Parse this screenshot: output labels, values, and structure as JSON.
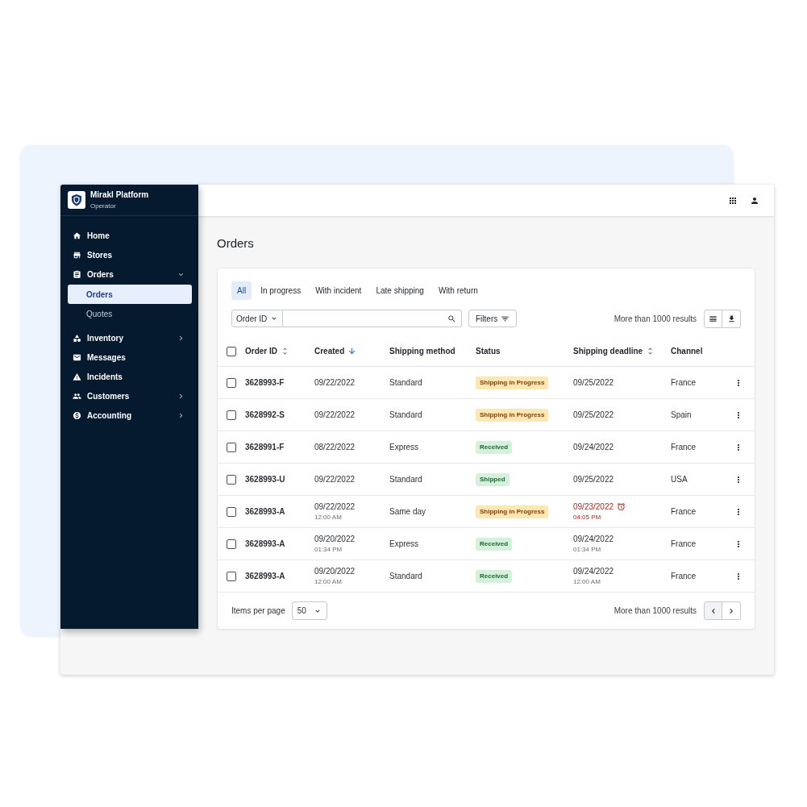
{
  "sidebar": {
    "brand": "Mirakl Platform",
    "role": "Operator",
    "items": [
      {
        "label": "Home",
        "selected": false
      },
      {
        "label": "Stores",
        "selected": false
      },
      {
        "label": "Orders",
        "selected": false,
        "expanded": true,
        "children": [
          {
            "label": "Orders",
            "selected": true
          },
          {
            "label": "Quotes",
            "selected": false
          }
        ]
      },
      {
        "label": "Inventory",
        "selected": false,
        "expanded": false
      },
      {
        "label": "Messages",
        "selected": false
      },
      {
        "label": "Incidents",
        "selected": false
      },
      {
        "label": "Customers",
        "selected": false,
        "expanded": false
      },
      {
        "label": "Accounting",
        "selected": false,
        "expanded": false
      }
    ]
  },
  "page_title": "Orders",
  "tabs": [
    {
      "label": "All",
      "selected": true
    },
    {
      "label": "In progress",
      "selected": false
    },
    {
      "label": "With incident",
      "selected": false
    },
    {
      "label": "Late shipping",
      "selected": false
    },
    {
      "label": "With return",
      "selected": false
    }
  ],
  "toolbar": {
    "search_scope": "Order ID",
    "filters": "Filters",
    "results": "More than 1000 results"
  },
  "table": {
    "select_all_checked": false,
    "columns": [
      {
        "label": "Order ID",
        "sortable": true,
        "sorted": false
      },
      {
        "label": "Created",
        "sortable": true,
        "sorted": true
      },
      {
        "label": "Shipping method",
        "sortable": false,
        "sorted": false
      },
      {
        "label": "Status",
        "sortable": false,
        "sorted": false
      },
      {
        "label": "Shipping deadline",
        "sortable": true,
        "sorted": false
      },
      {
        "label": "Channel",
        "sortable": false,
        "sorted": false
      }
    ],
    "rows": [
      {
        "checked": false,
        "order_id": "3628993-F",
        "created": {
          "date": "09/22/2022"
        },
        "shipping_method": "Standard",
        "status": {
          "label": "Shipping in Progress",
          "kind": "warning"
        },
        "deadline": {
          "date": "09/25/2022",
          "overdue": false
        },
        "channel": "France"
      },
      {
        "checked": false,
        "order_id": "3628992-S",
        "created": {
          "date": "09/22/2022"
        },
        "shipping_method": "Standard",
        "status": {
          "label": "Shipping in Progress",
          "kind": "warning"
        },
        "deadline": {
          "date": "09/25/2022",
          "overdue": false
        },
        "channel": "Spain"
      },
      {
        "checked": false,
        "order_id": "3628991-F",
        "created": {
          "date": "08/22/2022"
        },
        "shipping_method": "Express",
        "status": {
          "label": "Received",
          "kind": "success"
        },
        "deadline": {
          "date": "09/24/2022",
          "overdue": false
        },
        "channel": "France"
      },
      {
        "checked": false,
        "order_id": "3628993-U",
        "created": {
          "date": "09/22/2022"
        },
        "shipping_method": "Standard",
        "status": {
          "label": "Shipped",
          "kind": "success"
        },
        "deadline": {
          "date": "09/25/2022",
          "overdue": false
        },
        "channel": "USA"
      },
      {
        "checked": false,
        "order_id": "3628993-A",
        "created": {
          "date": "09/22/2022",
          "time": "12:00 AM"
        },
        "shipping_method": "Same day",
        "status": {
          "label": "Shipping in Progress",
          "kind": "warning"
        },
        "deadline": {
          "date": "09/23/2022",
          "time": "04:05 PM",
          "overdue": true
        },
        "channel": "France"
      },
      {
        "checked": false,
        "order_id": "3628993-A",
        "created": {
          "date": "09/20/2022",
          "time": "01:34 PM"
        },
        "shipping_method": "Express",
        "status": {
          "label": "Received",
          "kind": "success"
        },
        "deadline": {
          "date": "09/24/2022",
          "time": "01:34 PM",
          "overdue": false
        },
        "channel": "France"
      },
      {
        "checked": false,
        "order_id": "3628993-A",
        "created": {
          "date": "09/20/2022",
          "time": "12:00 AM"
        },
        "shipping_method": "Standard",
        "status": {
          "label": "Received",
          "kind": "success"
        },
        "deadline": {
          "date": "09/24/2022",
          "time": "12:00 AM",
          "overdue": false
        },
        "channel": "France"
      }
    ]
  },
  "pagination": {
    "items_per_page_label": "Items per page",
    "page_size": "50",
    "results": "More than 1000 results",
    "previous_disabled": true
  }
}
